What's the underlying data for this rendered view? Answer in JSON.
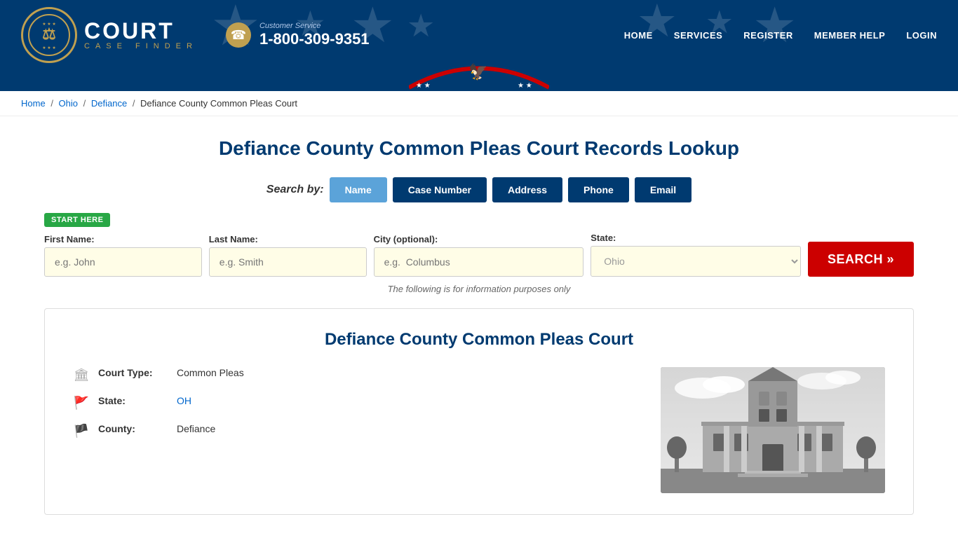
{
  "header": {
    "logo_title": "COURT",
    "logo_subtitle": "CASE FINDER",
    "phone_label": "Customer Service",
    "phone_number": "1-800-309-9351",
    "nav_items": [
      "HOME",
      "SERVICES",
      "REGISTER",
      "MEMBER HELP",
      "LOGIN"
    ]
  },
  "breadcrumb": {
    "items": [
      "Home",
      "Ohio",
      "Defiance",
      "Defiance County Common Pleas Court"
    ]
  },
  "page": {
    "title": "Defiance County Common Pleas Court Records Lookup"
  },
  "search": {
    "label": "Search by:",
    "tabs": [
      {
        "label": "Name",
        "active": true
      },
      {
        "label": "Case Number",
        "active": false
      },
      {
        "label": "Address",
        "active": false
      },
      {
        "label": "Phone",
        "active": false
      },
      {
        "label": "Email",
        "active": false
      }
    ],
    "start_here": "START HERE",
    "fields": {
      "first_name_label": "First Name:",
      "first_name_placeholder": "e.g. John",
      "last_name_label": "Last Name:",
      "last_name_placeholder": "e.g. Smith",
      "city_label": "City (optional):",
      "city_placeholder": "e.g.  Columbus",
      "state_label": "State:",
      "state_value": "Ohio"
    },
    "button_label": "SEARCH »",
    "info_note": "The following is for information purposes only"
  },
  "court_card": {
    "title": "Defiance County Common Pleas Court",
    "details": [
      {
        "icon": "building",
        "label": "Court Type:",
        "value": "Common Pleas",
        "link": false
      },
      {
        "icon": "flag",
        "label": "State:",
        "value": "OH",
        "link": true
      },
      {
        "icon": "pennant",
        "label": "County:",
        "value": "Defiance",
        "link": false
      }
    ]
  }
}
